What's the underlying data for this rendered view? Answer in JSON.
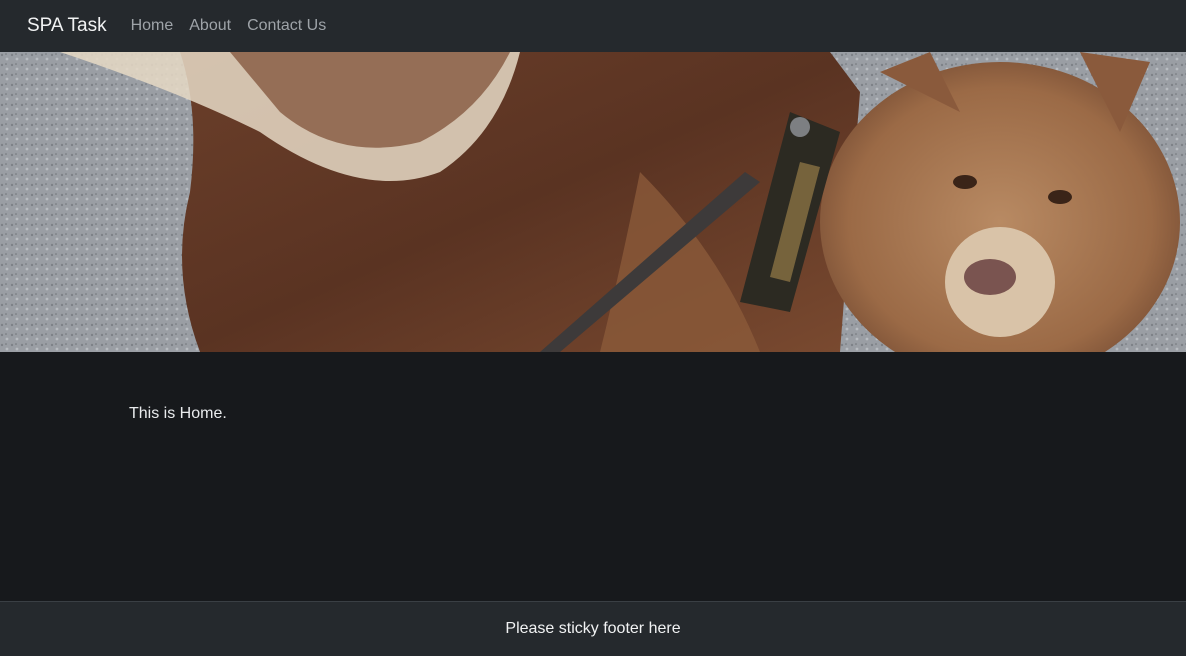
{
  "navbar": {
    "brand": "SPA Task",
    "links": [
      {
        "label": "Home"
      },
      {
        "label": "About"
      },
      {
        "label": "Contact Us"
      }
    ]
  },
  "main": {
    "text": "This is Home."
  },
  "footer": {
    "text": "Please sticky footer here"
  },
  "colors": {
    "navbar_bg": "#25292d",
    "page_bg": "#17191c",
    "nav_link": "#9ea3a8",
    "brand": "#f1f2f3"
  }
}
